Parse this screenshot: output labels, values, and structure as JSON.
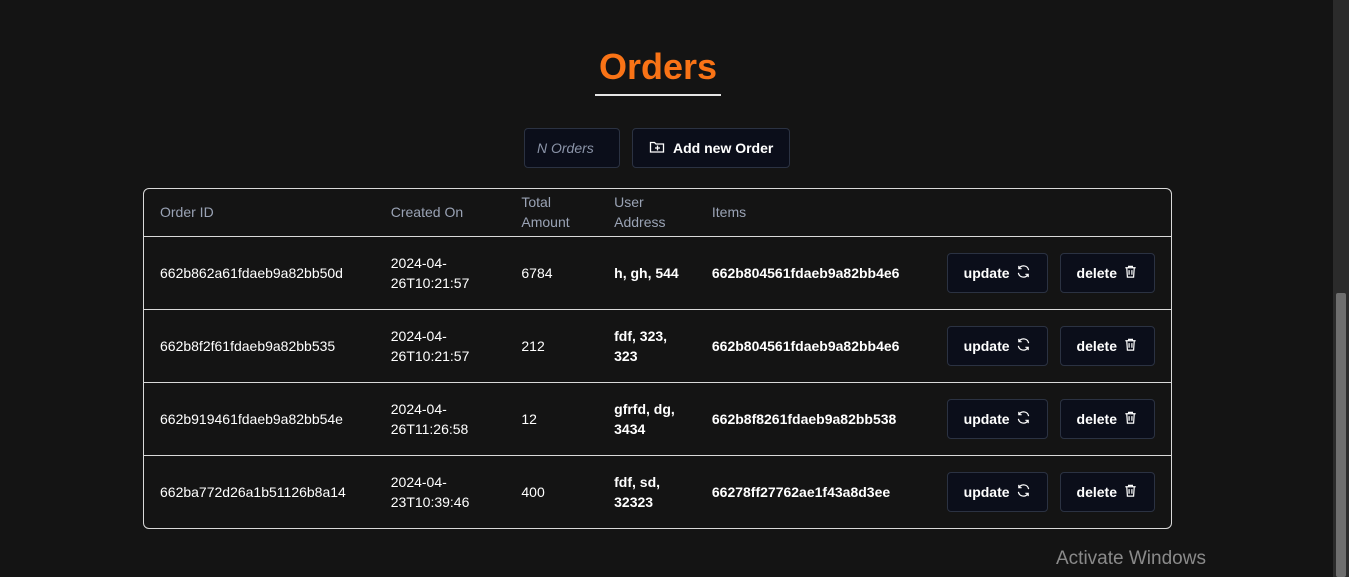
{
  "page": {
    "title": "Orders"
  },
  "toolbar": {
    "search_placeholder": "N Orders",
    "add_label": "Add new Order"
  },
  "table": {
    "headers": {
      "order_id": "Order ID",
      "created_on": "Created On",
      "total_amount": "Total Amount",
      "user_address": "User Address",
      "items": "Items"
    },
    "rows": [
      {
        "order_id": "662b862a61fdaeb9a82bb50d",
        "created_on": "2024-04-26T10:21:57",
        "total": "6784",
        "address": "h, gh, 544",
        "items": "662b804561fdaeb9a82bb4e6"
      },
      {
        "order_id": "662b8f2f61fdaeb9a82bb535",
        "created_on": "2024-04-26T10:21:57",
        "total": "212",
        "address": "fdf, 323, 323",
        "items": "662b804561fdaeb9a82bb4e6"
      },
      {
        "order_id": "662b919461fdaeb9a82bb54e",
        "created_on": "2024-04-26T11:26:58",
        "total": "12",
        "address": "gfrfd, dg, 3434",
        "items": "662b8f8261fdaeb9a82bb538"
      },
      {
        "order_id": "662ba772d26a1b51126b8a14",
        "created_on": "2024-04-23T10:39:46",
        "total": "400",
        "address": "fdf, sd, 32323",
        "items": "66278ff27762ae1f43a8d3ee"
      }
    ],
    "update_label": "update",
    "delete_label": "delete"
  },
  "icons": {
    "add": "folder-plus-icon",
    "update": "refresh-icon",
    "delete": "trash-icon"
  },
  "colors": {
    "accent": "#f97316",
    "background": "#141414",
    "button_bg": "#0b0e1a"
  },
  "watermark": {
    "text": "Activate Windows"
  }
}
